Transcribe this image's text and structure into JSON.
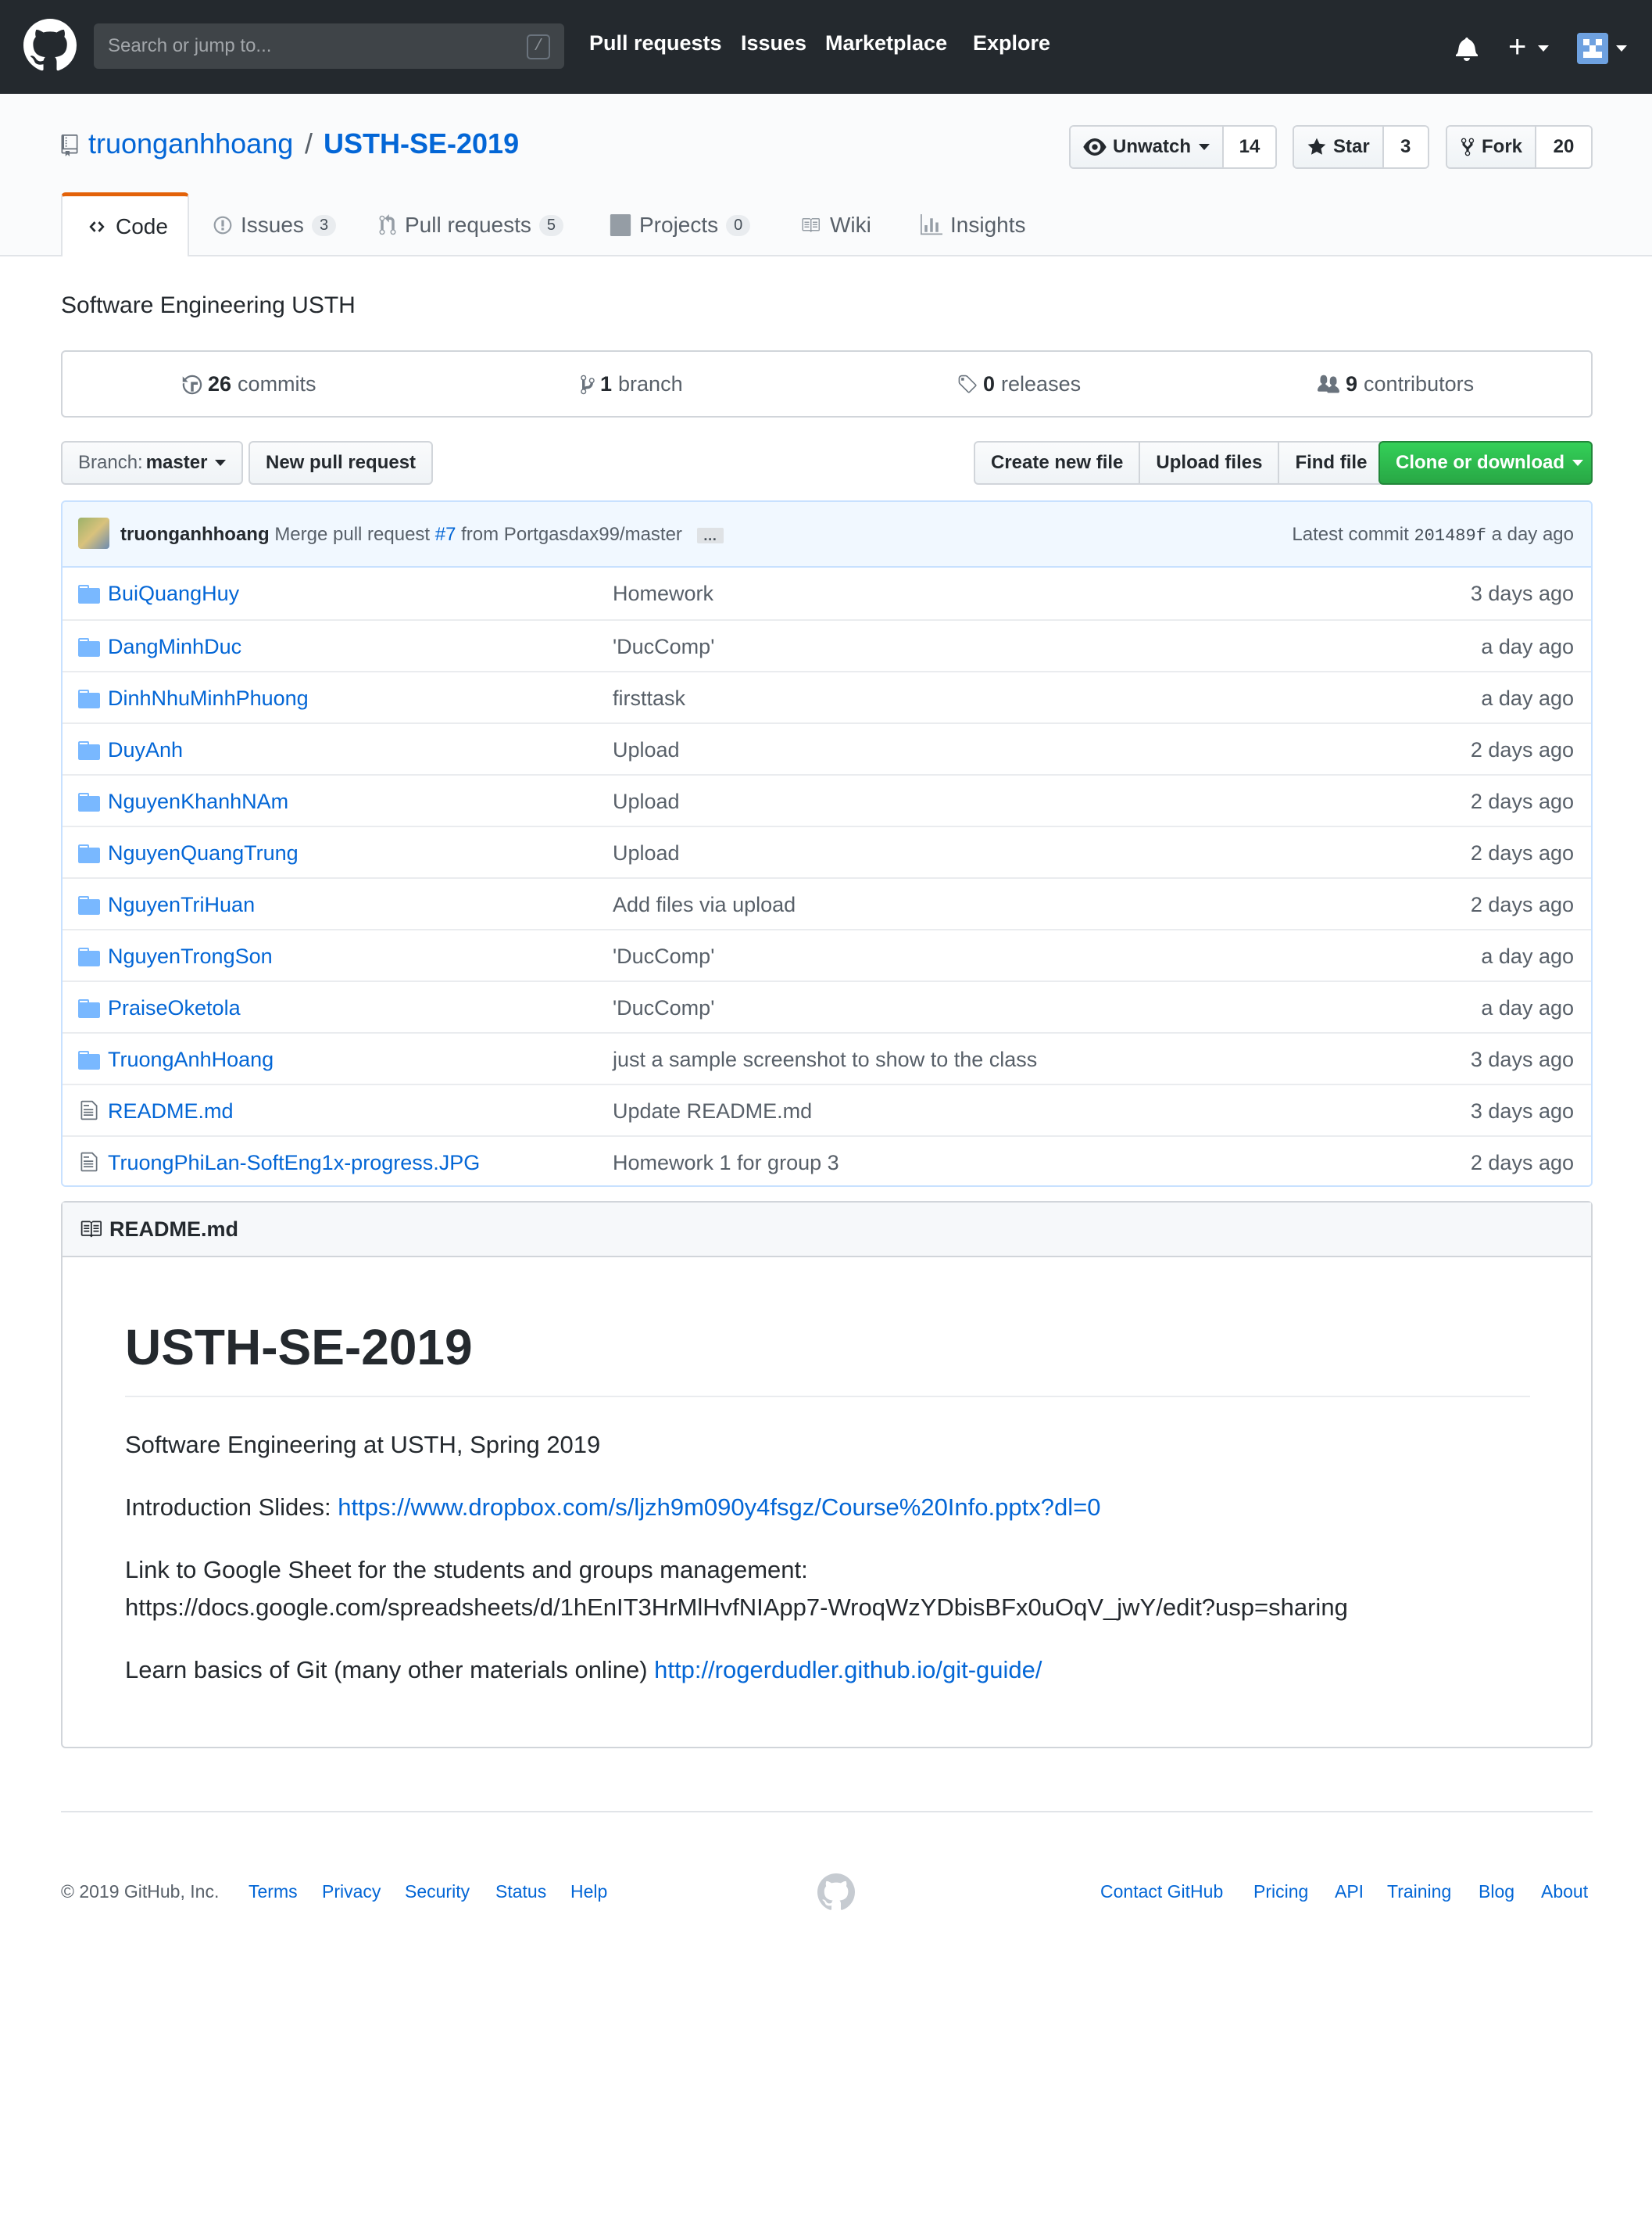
{
  "header": {
    "search_placeholder": "Search or jump to...",
    "search_shortcut": "/",
    "nav": [
      "Pull requests",
      "Issues",
      "Marketplace",
      "Explore"
    ],
    "plus": "+"
  },
  "repo": {
    "owner": "truonganhhoang",
    "separator": "/",
    "name": "USTH-SE-2019",
    "watch_label": "Unwatch",
    "watch_count": "14",
    "star_label": "Star",
    "star_count": "3",
    "fork_label": "Fork",
    "fork_count": "20"
  },
  "tabs": [
    {
      "label": "Code"
    },
    {
      "label": "Issues",
      "count": "3"
    },
    {
      "label": "Pull requests",
      "count": "5"
    },
    {
      "label": "Projects",
      "count": "0"
    },
    {
      "label": "Wiki"
    },
    {
      "label": "Insights"
    }
  ],
  "description": "Software Engineering USTH",
  "summary": {
    "commits_n": "26",
    "commits_label": "commits",
    "branch_n": "1",
    "branch_label": "branch",
    "releases_n": "0",
    "releases_label": "releases",
    "contributors_n": "9",
    "contributors_label": "contributors"
  },
  "file_nav": {
    "branch_prefix": "Branch:",
    "branch": "master",
    "new_pr": "New pull request",
    "create_file": "Create new file",
    "upload": "Upload files",
    "find": "Find file",
    "clone": "Clone or download"
  },
  "commit": {
    "author": "truonganhhoang",
    "msg_prefix": "Merge pull request",
    "pr_link": "#7",
    "msg_suffix": "from Portgasdax99/master",
    "ellipsis": "…",
    "latest_label": "Latest commit",
    "sha": "201489f",
    "age": "a day ago"
  },
  "files": [
    {
      "type": "dir",
      "name": "BuiQuangHuy",
      "message": "Homework",
      "age": "3 days ago"
    },
    {
      "type": "dir",
      "name": "DangMinhDuc",
      "message": "'DucComp'",
      "age": "a day ago"
    },
    {
      "type": "dir",
      "name": "DinhNhuMinhPhuong",
      "message": "firsttask",
      "age": "a day ago"
    },
    {
      "type": "dir",
      "name": "DuyAnh",
      "message": "Upload",
      "age": "2 days ago"
    },
    {
      "type": "dir",
      "name": "NguyenKhanhNAm",
      "message": "Upload",
      "age": "2 days ago"
    },
    {
      "type": "dir",
      "name": "NguyenQuangTrung",
      "message": "Upload",
      "age": "2 days ago"
    },
    {
      "type": "dir",
      "name": "NguyenTriHuan",
      "message": "Add files via upload",
      "age": "2 days ago"
    },
    {
      "type": "dir",
      "name": "NguyenTrongSon",
      "message": "'DucComp'",
      "age": "a day ago"
    },
    {
      "type": "dir",
      "name": "PraiseOketola",
      "message": "'DucComp'",
      "age": "a day ago"
    },
    {
      "type": "dir",
      "name": "TruongAnhHoang",
      "message": "just a sample screenshot to show to the class",
      "age": "3 days ago"
    },
    {
      "type": "file",
      "name": "README.md",
      "message": "Update README.md",
      "age": "3 days ago"
    },
    {
      "type": "file",
      "name": "TruongPhiLan-SoftEng1x-progress.JPG",
      "message": "Homework 1 for group 3",
      "age": "2 days ago"
    }
  ],
  "readme": {
    "header": "README.md",
    "title": "USTH-SE-2019",
    "p1": "Software Engineering at USTH, Spring 2019",
    "p2_text": "Introduction Slides:",
    "p2_link": "https://www.dropbox.com/s/ljzh9m090y4fsgz/Course%20Info.pptx?dl=0",
    "p3_text": "Link to Google Sheet for the students and groups management:",
    "p3_link": "https://docs.google.com/spreadsheets/d/1hEnIT3HrMlHvfNIApp7-WroqWzYDbisBFx0uOqV_jwY/edit?usp=sharing",
    "p4_text": "Learn basics of Git (many other materials online)",
    "p4_link": "http://rogerdudler.github.io/git-guide/"
  },
  "footer": {
    "copyright": "© 2019 GitHub, Inc.",
    "left_links": [
      "Terms",
      "Privacy",
      "Security",
      "Status",
      "Help"
    ],
    "right_links": [
      "Contact GitHub",
      "Pricing",
      "API",
      "Training",
      "Blog",
      "About"
    ]
  },
  "colors": {
    "header_bg": "#24292e",
    "link": "#0366d6",
    "tab_accent": "#e36209",
    "clone_green": "#28a745",
    "folder": "#79b8ff"
  }
}
